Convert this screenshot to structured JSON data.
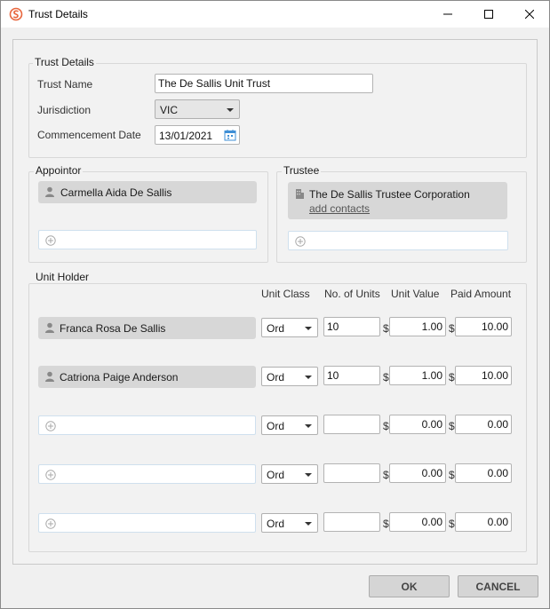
{
  "window": {
    "title": "Trust Details"
  },
  "trust_details": {
    "group_title": "Trust Details",
    "trust_name_label": "Trust Name",
    "trust_name_value": "The De Sallis Unit Trust",
    "jurisdiction_label": "Jurisdiction",
    "jurisdiction_value": "VIC",
    "commencement_label": "Commencement Date",
    "commencement_value": "13/01/2021"
  },
  "appointor": {
    "group_title": "Appointor",
    "name": "Carmella Aida De Sallis"
  },
  "trustee": {
    "group_title": "Trustee",
    "name": "The De Sallis Trustee Corporation",
    "add_contacts": "add contacts"
  },
  "unit_holder": {
    "group_title": "Unit Holder",
    "columns": {
      "unit_class": "Unit Class",
      "no_of_units": "No. of Units",
      "unit_value": "Unit Value",
      "paid_amount": "Paid Amount"
    },
    "currency_symbol": "$",
    "rows": [
      {
        "name": "Franca Rosa De Sallis",
        "unit_class": "Ord",
        "units": "10",
        "unit_value": "1.00",
        "paid_amount": "10.00"
      },
      {
        "name": "Catriona Paige Anderson",
        "unit_class": "Ord",
        "units": "10",
        "unit_value": "1.00",
        "paid_amount": "10.00"
      },
      {
        "name": "",
        "unit_class": "Ord",
        "units": "",
        "unit_value": "0.00",
        "paid_amount": "0.00"
      },
      {
        "name": "",
        "unit_class": "Ord",
        "units": "",
        "unit_value": "0.00",
        "paid_amount": "0.00"
      },
      {
        "name": "",
        "unit_class": "Ord",
        "units": "",
        "unit_value": "0.00",
        "paid_amount": "0.00"
      }
    ]
  },
  "buttons": {
    "ok": "OK",
    "cancel": "CANCEL"
  },
  "colors": {
    "app_icon": "#e8663d",
    "chip_bg": "#d7d7d7",
    "button_bg": "#d5d5d5"
  }
}
